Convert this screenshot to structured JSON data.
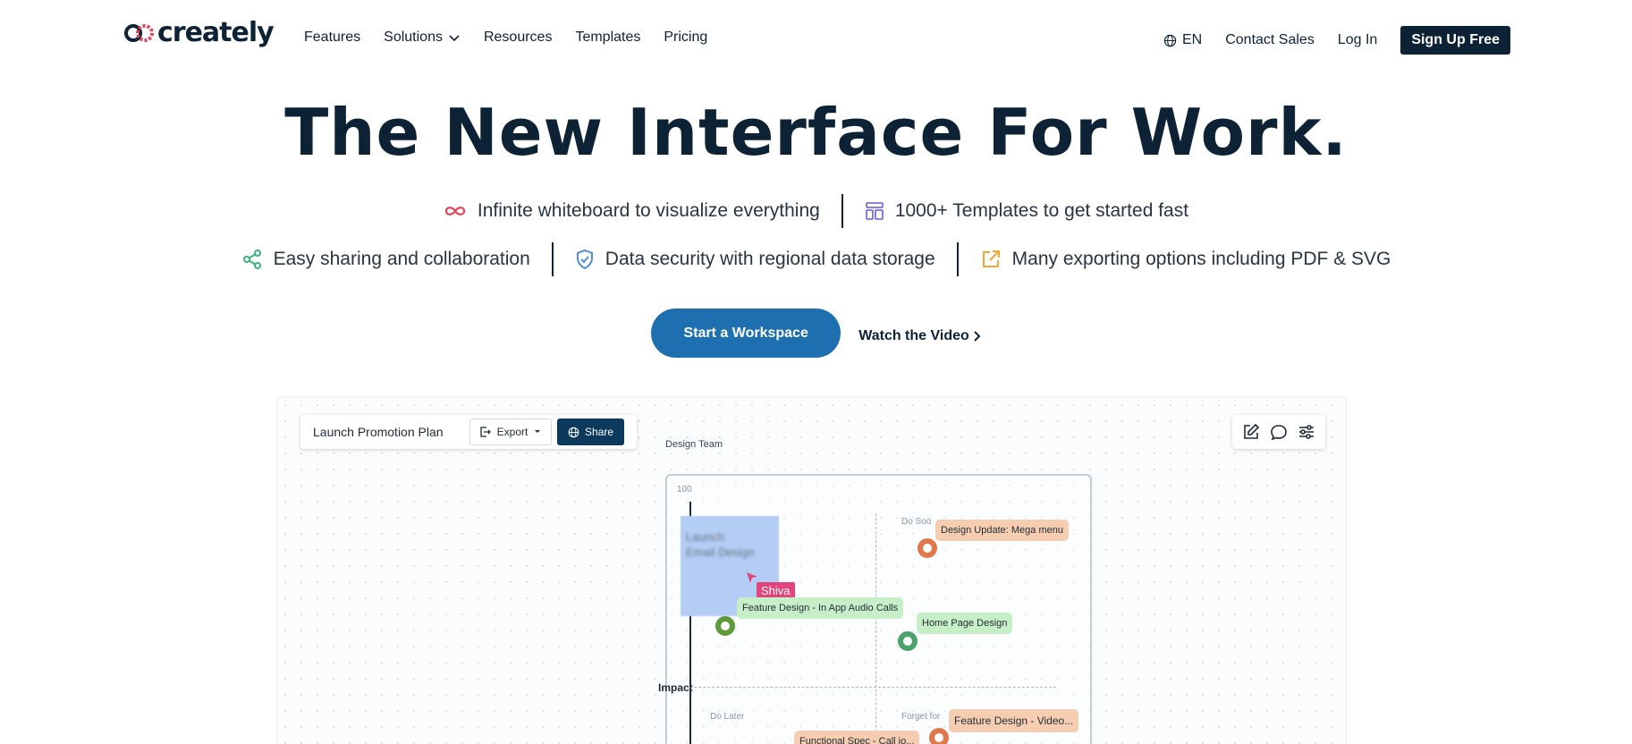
{
  "nav": {
    "logo_text": "creately",
    "links": [
      "Features",
      "Solutions",
      "Resources",
      "Templates",
      "Pricing"
    ],
    "language": "EN",
    "contact_sales": "Contact Sales",
    "login": "Log In",
    "signup": "Sign Up Free"
  },
  "hero": {
    "headline": "The New Interface For Work.",
    "features_row1": [
      {
        "icon": "infinity-icon",
        "text": "Infinite whiteboard to visualize everything",
        "color": "#e0455a"
      },
      {
        "icon": "templates-icon",
        "text": "1000+ Templates to get started fast",
        "color": "#7b6fd8"
      }
    ],
    "features_row2": [
      {
        "icon": "share-icon",
        "text": "Easy sharing and collaboration",
        "color": "#3bb27a"
      },
      {
        "icon": "shield-icon",
        "text": "Data security with regional data storage",
        "color": "#4f8fd8"
      },
      {
        "icon": "export-icon",
        "text": "Many exporting options including PDF & SVG",
        "color": "#f0a733"
      }
    ],
    "cta_primary": "Start a Workspace",
    "cta_video": "Watch the Video"
  },
  "preview": {
    "doc_title": "Launch Promotion Plan",
    "export_label": "Export",
    "share_label": "Share",
    "frame_label": "Design Team",
    "axis_max": "100",
    "axis_label": "Impact",
    "quadrants": {
      "top_right": "Do Soo",
      "bottom_left": "Do Later",
      "bottom_right": "Forget for"
    },
    "sticky_text_line1": "Launch",
    "sticky_text_line2": "Email Design",
    "cursor_user": "Shiva",
    "cards": [
      {
        "text": "Design Update: Mega menu",
        "color": "orange"
      },
      {
        "text": "Feature Design - In App Audio Calls",
        "color": "green"
      },
      {
        "text": "Home Page Design",
        "color": "green"
      },
      {
        "text": "Feature Design - Video...",
        "color": "orange"
      },
      {
        "text": "Functional Spec - Call jo...",
        "color": "orange"
      }
    ]
  }
}
